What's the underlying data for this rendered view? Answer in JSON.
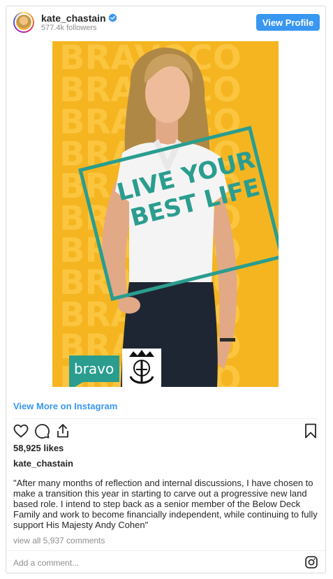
{
  "header": {
    "username": "kate_chastain",
    "followers": "577.4k followers",
    "view_profile_label": "View Profile"
  },
  "media": {
    "background_words": [
      "BRAVOCO",
      "BRAVOCO",
      "BRAVOCO",
      "BRAVOCO",
      "BRAVOCO",
      "BRAVOCO",
      "BRAVOCO",
      "BRAVOCO",
      "BRAVOCO",
      "BRAVOCO",
      "BRAVOCO"
    ],
    "headline_line1": "LIVE YOUR",
    "headline_line2": "BEST LIFE",
    "logo_text": "bravo",
    "colors": {
      "background": "#f5b521",
      "background_text": "#fbc53f",
      "accent_teal": "#2a9d8f",
      "shirt": "#f4f4f4",
      "skirt": "#1f2633"
    }
  },
  "view_more_label": "View More on Instagram",
  "likes": "58,925 likes",
  "author": "kate_chastain",
  "caption": "\"After many months of reflection and internal discussions, I have chosen to make a transition this year in starting to carve out a progressive new land based role. I intend to step back as a senior member of the Below Deck Family and work to become financially independent, while continuing to fully support His Majesty Andy Cohen\"",
  "comments_link": "view all 5,937 comments",
  "comment_placeholder": "Add a comment...",
  "colors": {
    "link_blue": "#3897f0",
    "muted_text": "#8e8e8e",
    "border": "#dbdbdb"
  },
  "icons": [
    "verified-badge-icon",
    "heart-icon",
    "comment-icon",
    "share-icon",
    "bookmark-icon",
    "instagram-icon"
  ]
}
